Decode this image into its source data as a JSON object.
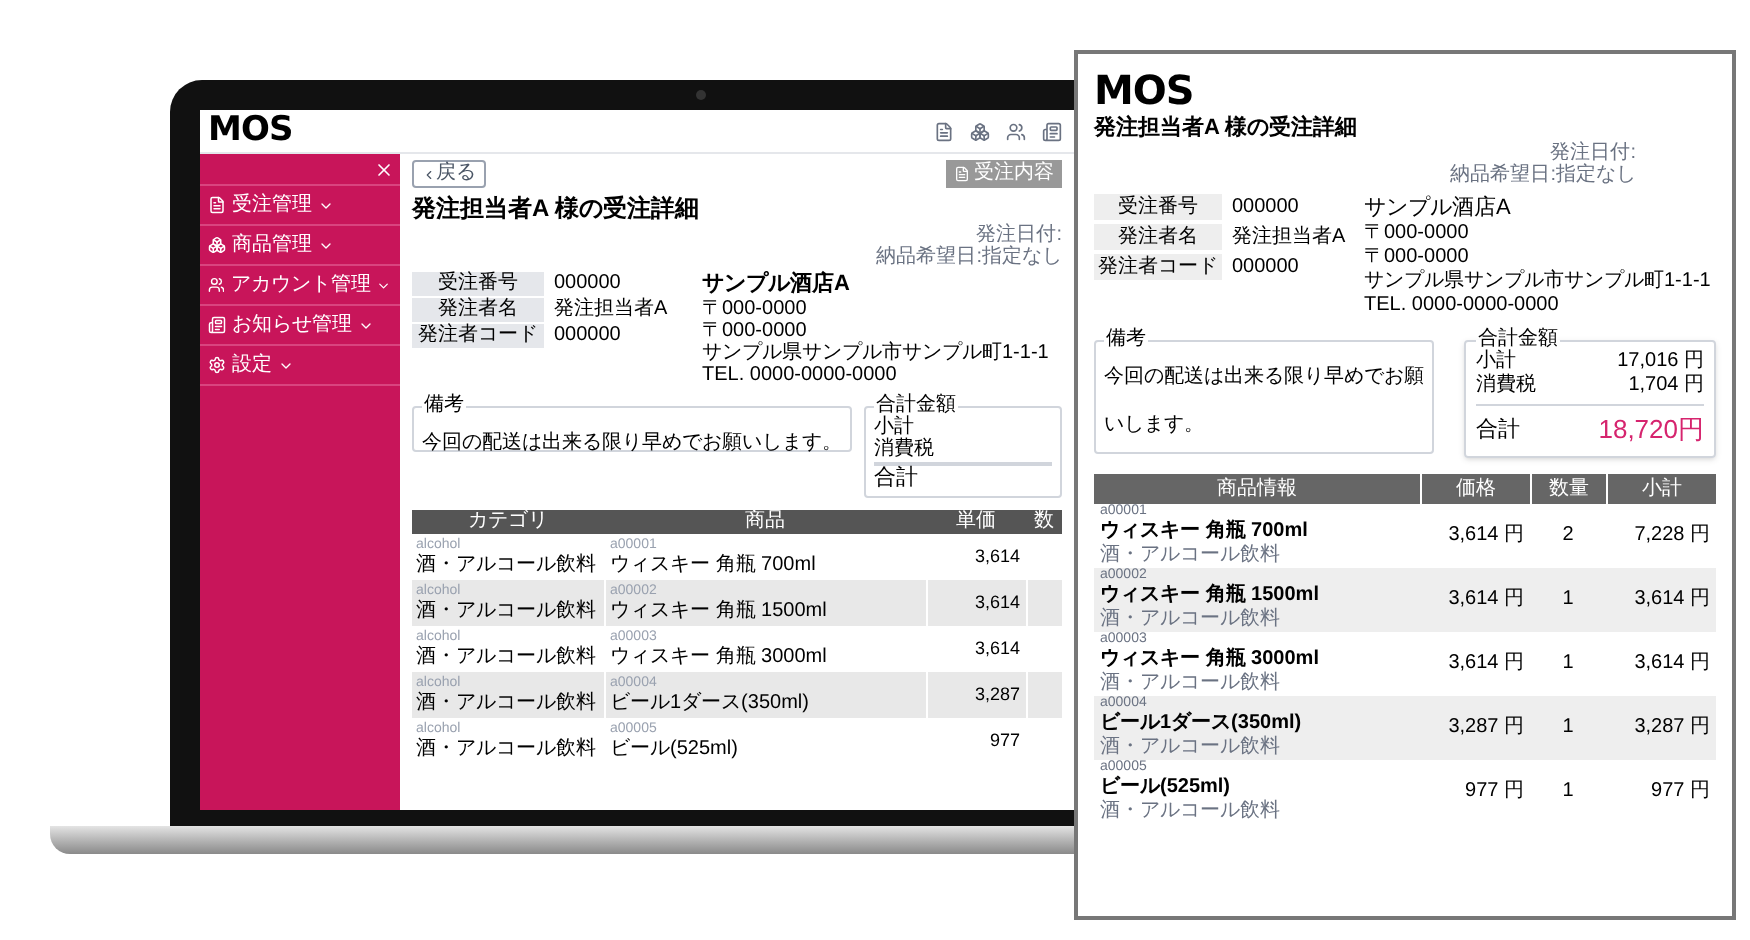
{
  "laptop": {
    "logo": "MOS",
    "sidebar": {
      "items": [
        {
          "label": "受注管理"
        },
        {
          "label": "商品管理"
        },
        {
          "label": "アカウント管理"
        },
        {
          "label": "お知らせ管理"
        },
        {
          "label": "設定"
        }
      ]
    },
    "back_button": "戻る",
    "action_button": "受注内容",
    "title": "発注担当者A 様の受注詳細",
    "dates": [
      "発注日付:",
      "納品希望日:指定なし"
    ],
    "info": [
      {
        "label": "受注番号",
        "value": "000000"
      },
      {
        "label": "発注者名",
        "value": "発注担当者A"
      },
      {
        "label": "発注者コード",
        "value": "000000"
      }
    ],
    "shop": {
      "name": "サンプル酒店A",
      "lines": [
        "〒000-0000",
        "〒000-0000",
        "サンプル県サンプル市サンプル町1-1-1",
        "TEL. 0000-0000-0000"
      ]
    },
    "notes": {
      "legend": "備考",
      "text": "今回の配送は出来る限り早めでお願いします。"
    },
    "totals": {
      "legend": "合計金額",
      "rows": [
        "小計",
        "消費税"
      ],
      "total": "合計"
    },
    "table": {
      "columns": [
        "カテゴリ",
        "商品",
        "単価",
        "数"
      ],
      "rows": [
        {
          "category_code": "alcohol",
          "category": "酒・アルコール飲料",
          "code": "a00001",
          "product": "ウィスキー 角瓶 700ml",
          "price": "3,614"
        },
        {
          "category_code": "alcohol",
          "category": "酒・アルコール飲料",
          "code": "a00002",
          "product": "ウィスキー 角瓶 1500ml",
          "price": "3,614"
        },
        {
          "category_code": "alcohol",
          "category": "酒・アルコール飲料",
          "code": "a00003",
          "product": "ウィスキー 角瓶 3000ml",
          "price": "3,614"
        },
        {
          "category_code": "alcohol",
          "category": "酒・アルコール飲料",
          "code": "a00004",
          "product": "ビール1ダース(350ml)",
          "price": "3,287"
        },
        {
          "category_code": "alcohol",
          "category": "酒・アルコール飲料",
          "code": "a00005",
          "product": "ビール(525ml)",
          "price": "977"
        }
      ]
    }
  },
  "document": {
    "logo": "MOS",
    "title": "発注担当者A 様の受注詳細",
    "dates": [
      "発注日付:",
      "納品希望日:指定なし"
    ],
    "info": [
      {
        "label": "受注番号",
        "value": "000000"
      },
      {
        "label": "発注者名",
        "value": "発注担当者A"
      },
      {
        "label": "発注者コード",
        "value": "000000"
      }
    ],
    "shop": {
      "name": "サンプル酒店A",
      "lines": [
        "〒000-0000",
        "〒000-0000",
        "サンプル県サンプル市サンプル町1-1-1",
        "TEL. 0000-0000-0000"
      ]
    },
    "notes": {
      "legend": "備考",
      "text": "今回の配送は出来る限り早めでお願いします。"
    },
    "totals": {
      "legend": "合計金額",
      "rows": [
        {
          "label": "小計",
          "value": "17,016 円"
        },
        {
          "label": "消費税",
          "value": "1,704 円"
        }
      ],
      "total_label": "合計",
      "total_value": "18,720円"
    },
    "table": {
      "columns": [
        "商品情報",
        "価格",
        "数量",
        "小計"
      ],
      "rows": [
        {
          "code": "a00001",
          "product": "ウィスキー 角瓶 700ml",
          "category": "酒・アルコール飲料",
          "price": "3,614 円",
          "qty": "2",
          "subtotal": "7,228 円"
        },
        {
          "code": "a00002",
          "product": "ウィスキー 角瓶 1500ml",
          "category": "酒・アルコール飲料",
          "price": "3,614 円",
          "qty": "1",
          "subtotal": "3,614 円"
        },
        {
          "code": "a00003",
          "product": "ウィスキー 角瓶 3000ml",
          "category": "酒・アルコール飲料",
          "price": "3,614 円",
          "qty": "1",
          "subtotal": "3,614 円"
        },
        {
          "code": "a00004",
          "product": "ビール1ダース(350ml)",
          "category": "酒・アルコール飲料",
          "price": "3,287 円",
          "qty": "1",
          "subtotal": "3,287 円"
        },
        {
          "code": "a00005",
          "product": "ビール(525ml)",
          "category": "酒・アルコール飲料",
          "price": "977 円",
          "qty": "1",
          "subtotal": "977 円"
        }
      ]
    }
  }
}
